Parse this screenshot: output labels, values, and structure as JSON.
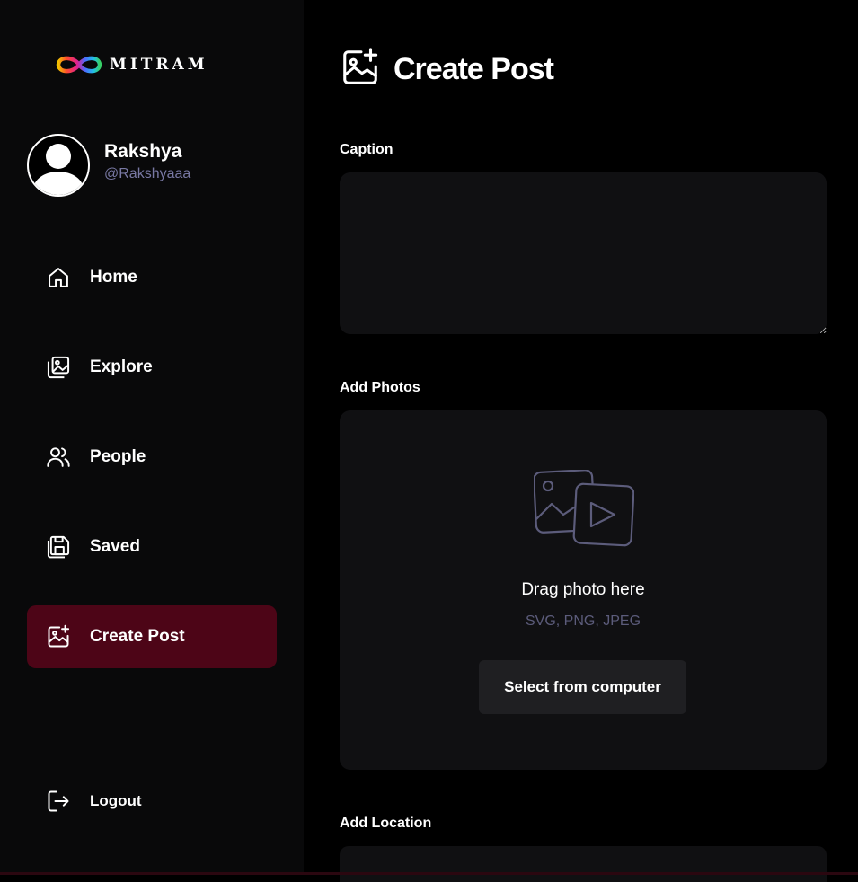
{
  "app": {
    "logo_text": "MITRAM",
    "accent_color": "#4d0517",
    "sidebar_bg": "#09090a",
    "handle_color": "#7878a3"
  },
  "profile": {
    "name": "Rakshya",
    "handle": "@Rakshyaaa",
    "avatar_icon": "user-avatar-icon"
  },
  "nav": {
    "items": [
      {
        "label": "Home",
        "icon": "home-icon"
      },
      {
        "label": "Explore",
        "icon": "gallery-icon"
      },
      {
        "label": "People",
        "icon": "people-icon"
      },
      {
        "label": "Saved",
        "icon": "bookmark-icon"
      },
      {
        "label": "Create Post",
        "icon": "image-add-icon",
        "active": true
      }
    ],
    "logout_label": "Logout"
  },
  "page": {
    "title": "Create Post",
    "title_icon": "image-add-icon"
  },
  "form": {
    "caption_label": "Caption",
    "caption_value": "",
    "photos_label": "Add Photos",
    "upload_title": "Drag photo here",
    "upload_formats": "SVG, PNG, JPEG",
    "select_button": "Select from computer",
    "location_label": "Add Location"
  }
}
